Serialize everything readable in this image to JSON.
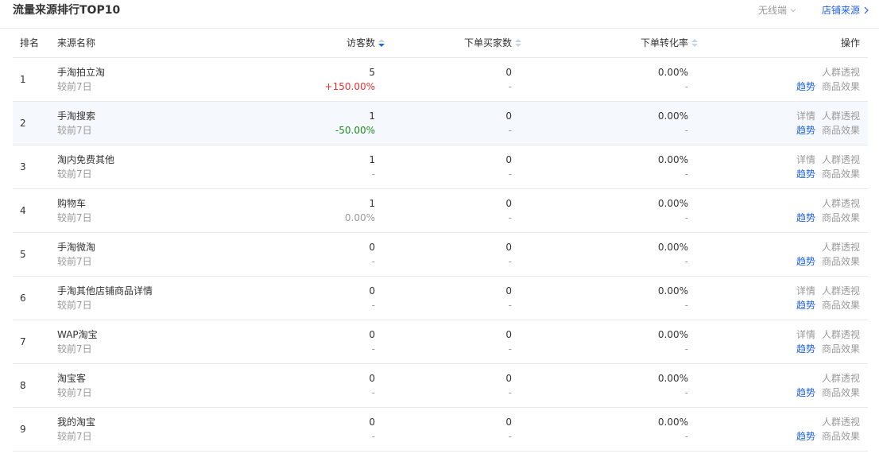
{
  "header": {
    "title": "流量来源排行TOP10",
    "device_label": "无线端",
    "shop_link": "店铺来源"
  },
  "columns": {
    "rank": "排名",
    "source": "来源名称",
    "visitors": "访客数",
    "buyers": "下单买家数",
    "conversion": "下单转化率",
    "actions": "操作"
  },
  "rows": [
    {
      "rank": "1",
      "name": "手淘拍立淘",
      "compare": "较前7日",
      "uv": "5",
      "uv_delta": "+150.00%",
      "uv_delta_type": "up",
      "buyers": "0",
      "buyers_delta": "-",
      "conv": "0.00%",
      "conv_delta": "-",
      "detail": "",
      "crowd": "人群透视",
      "trend": "趋势",
      "goods": "商品效果"
    },
    {
      "rank": "2",
      "name": "手淘搜索",
      "compare": "较前7日",
      "uv": "1",
      "uv_delta": "-50.00%",
      "uv_delta_type": "down",
      "buyers": "0",
      "buyers_delta": "-",
      "conv": "0.00%",
      "conv_delta": "-",
      "detail": "详情",
      "crowd": "人群透视",
      "trend": "趋势",
      "goods": "商品效果"
    },
    {
      "rank": "3",
      "name": "淘内免费其他",
      "compare": "较前7日",
      "uv": "1",
      "uv_delta": "-",
      "uv_delta_type": "none",
      "buyers": "0",
      "buyers_delta": "-",
      "conv": "0.00%",
      "conv_delta": "-",
      "detail": "详情",
      "crowd": "人群透视",
      "trend": "趋势",
      "goods": "商品效果"
    },
    {
      "rank": "4",
      "name": "购物车",
      "compare": "较前7日",
      "uv": "1",
      "uv_delta": "0.00%",
      "uv_delta_type": "none",
      "buyers": "0",
      "buyers_delta": "-",
      "conv": "0.00%",
      "conv_delta": "-",
      "detail": "",
      "crowd": "人群透视",
      "trend": "趋势",
      "goods": "商品效果"
    },
    {
      "rank": "5",
      "name": "手淘微淘",
      "compare": "较前7日",
      "uv": "0",
      "uv_delta": "-",
      "uv_delta_type": "none",
      "buyers": "0",
      "buyers_delta": "-",
      "conv": "0.00%",
      "conv_delta": "-",
      "detail": "",
      "crowd": "人群透视",
      "trend": "趋势",
      "goods": "商品效果"
    },
    {
      "rank": "6",
      "name": "手淘其他店铺商品详情",
      "compare": "较前7日",
      "uv": "0",
      "uv_delta": "-",
      "uv_delta_type": "none",
      "buyers": "0",
      "buyers_delta": "-",
      "conv": "0.00%",
      "conv_delta": "-",
      "detail": "详情",
      "crowd": "人群透视",
      "trend": "趋势",
      "goods": "商品效果"
    },
    {
      "rank": "7",
      "name": "WAP淘宝",
      "compare": "较前7日",
      "uv": "0",
      "uv_delta": "-",
      "uv_delta_type": "none",
      "buyers": "0",
      "buyers_delta": "-",
      "conv": "0.00%",
      "conv_delta": "-",
      "detail": "详情",
      "crowd": "人群透视",
      "trend": "趋势",
      "goods": "商品效果"
    },
    {
      "rank": "8",
      "name": "淘宝客",
      "compare": "较前7日",
      "uv": "0",
      "uv_delta": "-",
      "uv_delta_type": "none",
      "buyers": "0",
      "buyers_delta": "-",
      "conv": "0.00%",
      "conv_delta": "-",
      "detail": "",
      "crowd": "人群透视",
      "trend": "趋势",
      "goods": "商品效果"
    },
    {
      "rank": "9",
      "name": "我的淘宝",
      "compare": "较前7日",
      "uv": "0",
      "uv_delta": "-",
      "uv_delta_type": "none",
      "buyers": "0",
      "buyers_delta": "-",
      "conv": "0.00%",
      "conv_delta": "-",
      "detail": "",
      "crowd": "人群透视",
      "trend": "趋势",
      "goods": "商品效果"
    }
  ],
  "colors": {
    "link": "#2062e6",
    "up": "#e5322d",
    "down": "#1f8a1f",
    "muted": "#999999"
  },
  "highlighted_row": 2
}
